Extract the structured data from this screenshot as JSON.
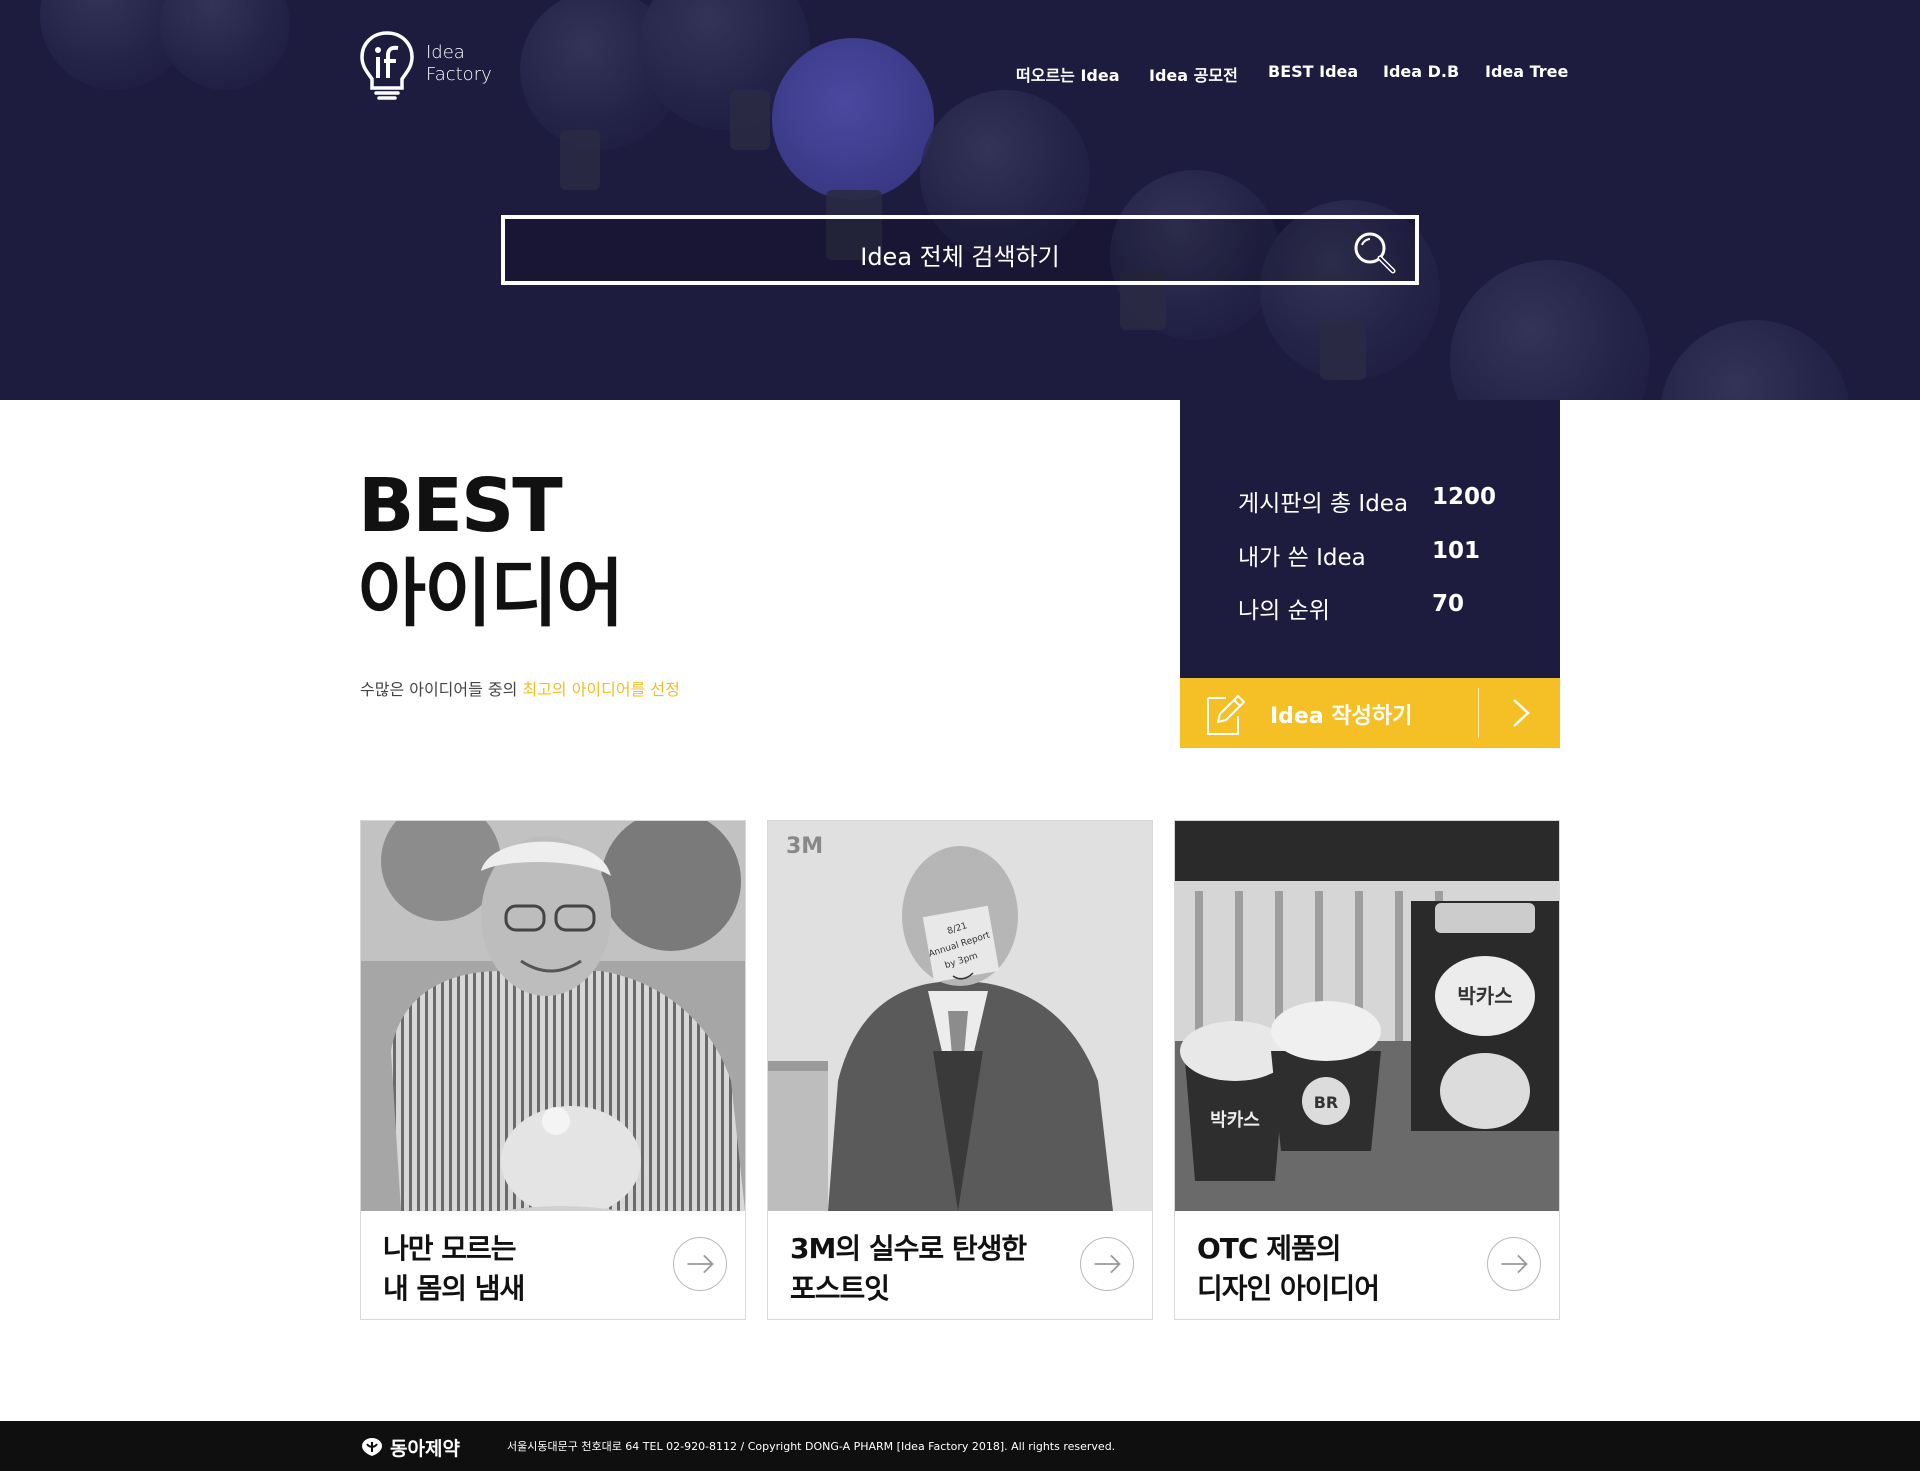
{
  "logo": {
    "line1": "Idea",
    "line2": "Factory"
  },
  "nav": {
    "items": [
      {
        "label": "떠오르는 Idea"
      },
      {
        "label": "Idea 공모전"
      },
      {
        "label": "BEST Idea"
      },
      {
        "label": "Idea D.B"
      },
      {
        "label": "Idea Tree"
      }
    ]
  },
  "search": {
    "placeholder": "Idea 전체 검색하기",
    "icon": "search-icon"
  },
  "best": {
    "title_line1": "BEST",
    "title_line2": "아이디어",
    "subtitle_prefix": "수많은 아이디어들 중의 ",
    "subtitle_highlight": "최고의 아이디어를 선정",
    "highlight_color": "#f3be22"
  },
  "stats": {
    "rows": [
      {
        "label": "게시판의 총 Idea",
        "value": "1200"
      },
      {
        "label": "내가 쓴 Idea",
        "value": "101"
      },
      {
        "label": "나의 순위",
        "value": "70"
      }
    ],
    "background": "#1d1b3e"
  },
  "write_button": {
    "label": "Idea 작성하기",
    "icon": "pencil-note-icon",
    "arrow": "chevron-right-icon",
    "background": "#f4c025"
  },
  "cards": [
    {
      "title_line1": "나만 모르는",
      "title_line2": "내 몸의 냄새",
      "image": "elderly-man-with-baby-photo"
    },
    {
      "title_line1": "3M의 실수로 탄생한",
      "title_line2": "포스트잇",
      "image": "man-with-post-it-note-photo"
    },
    {
      "title_line1": "OTC 제품의",
      "title_line2": "디자인 아이디어",
      "image": "bacchus-ice-cream-photo"
    }
  ],
  "footer": {
    "brand": "동아제약",
    "info": "서울시동대문구 천호대로 64    TEL 02-920-8112    /    Copyright DONG-A PHARM [Idea Factory 2018]. All rights reserved."
  },
  "colors": {
    "navy": "#1d1b3e",
    "yellow": "#f4c025",
    "footer": "#0f0f0f"
  }
}
